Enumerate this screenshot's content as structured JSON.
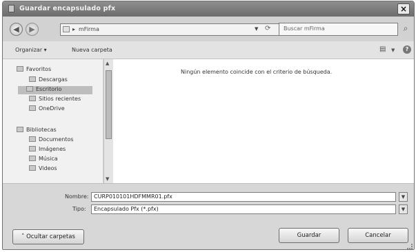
{
  "window": {
    "title": "Guardar encapsulado pfx",
    "close_label": "×"
  },
  "address": {
    "breadcrumb_sep": "▸",
    "path": "mFirma",
    "search_placeholder": "Buscar mFirma"
  },
  "toolbar": {
    "organize": "Organizar ▾",
    "new_folder": "Nueva carpeta"
  },
  "nav": {
    "items": [
      {
        "label": "Favoritos",
        "icon": "star-icon"
      },
      {
        "label": "Descargas",
        "icon": "download-icon"
      },
      {
        "label": "Escritorio",
        "icon": "desktop-icon",
        "selected": true
      },
      {
        "label": "Sitios recientes",
        "icon": "recent-icon"
      },
      {
        "label": "OneDrive",
        "icon": "cloud-icon"
      },
      {
        "label": "Bibliotecas",
        "icon": "library-icon"
      },
      {
        "label": "Documentos",
        "icon": "documents-icon"
      },
      {
        "label": "Imágenes",
        "icon": "images-icon"
      },
      {
        "label": "Música",
        "icon": "music-icon"
      },
      {
        "label": "Videos",
        "icon": "video-icon"
      }
    ]
  },
  "content": {
    "empty_message": "Ningún elemento coincide con el criterio de búsqueda."
  },
  "form": {
    "name_label": "Nombre:",
    "name_value": "CURP010101HDFMMR01.pfx",
    "type_label": "Tipo:",
    "type_value": "Encapsulado Pfx (*.pfx)"
  },
  "buttons": {
    "hide_folders": "Ocultar carpetas",
    "save": "Guardar",
    "cancel": "Cancelar"
  }
}
